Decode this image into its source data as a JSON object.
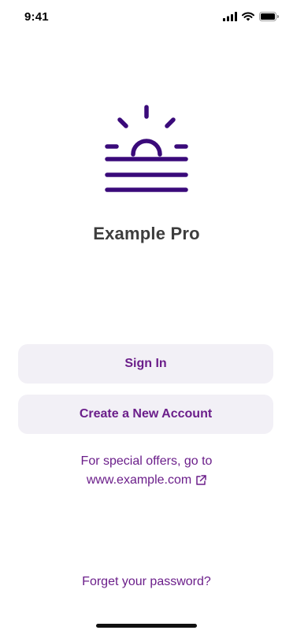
{
  "status_bar": {
    "time": "9:41",
    "icons": [
      "cellular-signal-icon",
      "wifi-icon",
      "battery-icon"
    ]
  },
  "logo": {
    "icon": "sunrise-icon",
    "color": "#3a0a7a"
  },
  "app_title": "Example Pro",
  "buttons": {
    "sign_in": "Sign In",
    "create_account": "Create a New Account"
  },
  "offer": {
    "line1": "For special offers, go to",
    "link_text": "www.example.com",
    "link_icon": "external-link-icon"
  },
  "forgot_password": "Forget your password?",
  "colors": {
    "accent": "#6b1e8a",
    "logo": "#3a0a7a",
    "button_bg": "#f2f0f6",
    "title": "#3d3d3d"
  }
}
